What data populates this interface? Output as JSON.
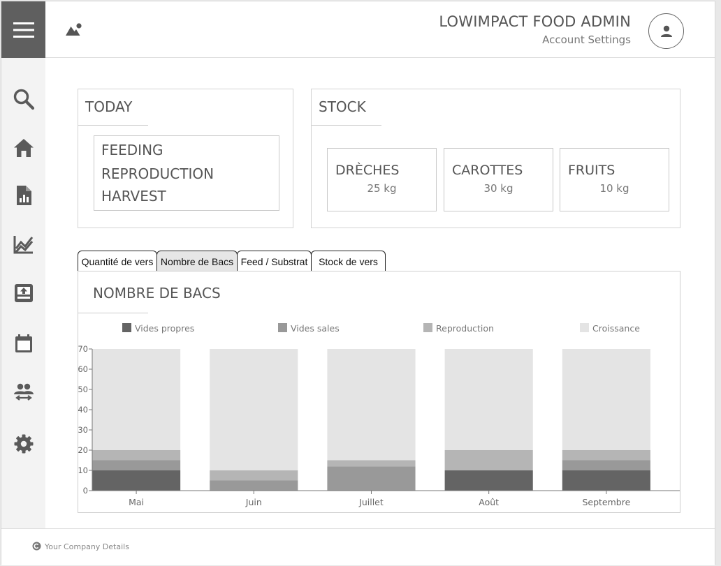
{
  "header": {
    "title": "LOWIMPACT FOOD ADMIN",
    "account_link": "Account Settings"
  },
  "sidebar": {
    "items": [
      {
        "name": "search",
        "icon": "search-icon"
      },
      {
        "name": "home",
        "icon": "home-icon"
      },
      {
        "name": "report",
        "icon": "report-icon"
      },
      {
        "name": "analytics",
        "icon": "line-chart-icon"
      },
      {
        "name": "inbox",
        "icon": "inbox-icon"
      },
      {
        "name": "calendar",
        "icon": "calendar-icon"
      },
      {
        "name": "people",
        "icon": "people-swap-icon"
      },
      {
        "name": "settings",
        "icon": "gear-icon"
      }
    ]
  },
  "today": {
    "title": "TODAY",
    "items": [
      "FEEDING",
      "REPRODUCTION",
      "HARVEST"
    ]
  },
  "stock": {
    "title": "STOCK",
    "items": [
      {
        "name": "DRÈCHES",
        "qty": "25 kg"
      },
      {
        "name": "CAROTTES",
        "qty": "30 kg"
      },
      {
        "name": "FRUITS",
        "qty": "10 kg"
      }
    ]
  },
  "tabs": [
    {
      "label": "Quantité de vers",
      "active": false
    },
    {
      "label": "Nombre de Bacs",
      "active": true
    },
    {
      "label": "Feed / Substrat",
      "active": false
    },
    {
      "label": "Stock de vers",
      "active": false
    }
  ],
  "chart_data": {
    "type": "bar",
    "title": "NOMBRE DE BACS",
    "stacked": true,
    "categories": [
      "Mai",
      "Juin",
      "Juillet",
      "Août",
      "Septembre"
    ],
    "series": [
      {
        "name": "Vides propres",
        "color": "#646464",
        "values": [
          10,
          0,
          0,
          10,
          10
        ]
      },
      {
        "name": "Vides sales",
        "color": "#999999",
        "values": [
          5,
          5,
          12,
          0,
          5
        ]
      },
      {
        "name": "Reproduction",
        "color": "#b5b5b5",
        "values": [
          5,
          5,
          3,
          10,
          5
        ]
      },
      {
        "name": "Croissance",
        "color": "#e4e4e4",
        "values": [
          50,
          60,
          55,
          50,
          50
        ]
      }
    ],
    "ylim": [
      0,
      70
    ],
    "yticks": [
      0,
      10,
      20,
      30,
      40,
      50,
      60,
      70
    ],
    "legend_position": "top"
  },
  "footer": {
    "text": "Your Company Details"
  },
  "colors": {
    "menu_bg": "#5f5f5f",
    "sidebar_bg": "#f3f3f3",
    "icon": "#5a5a5a",
    "active_tab": "#e6e6e6"
  }
}
